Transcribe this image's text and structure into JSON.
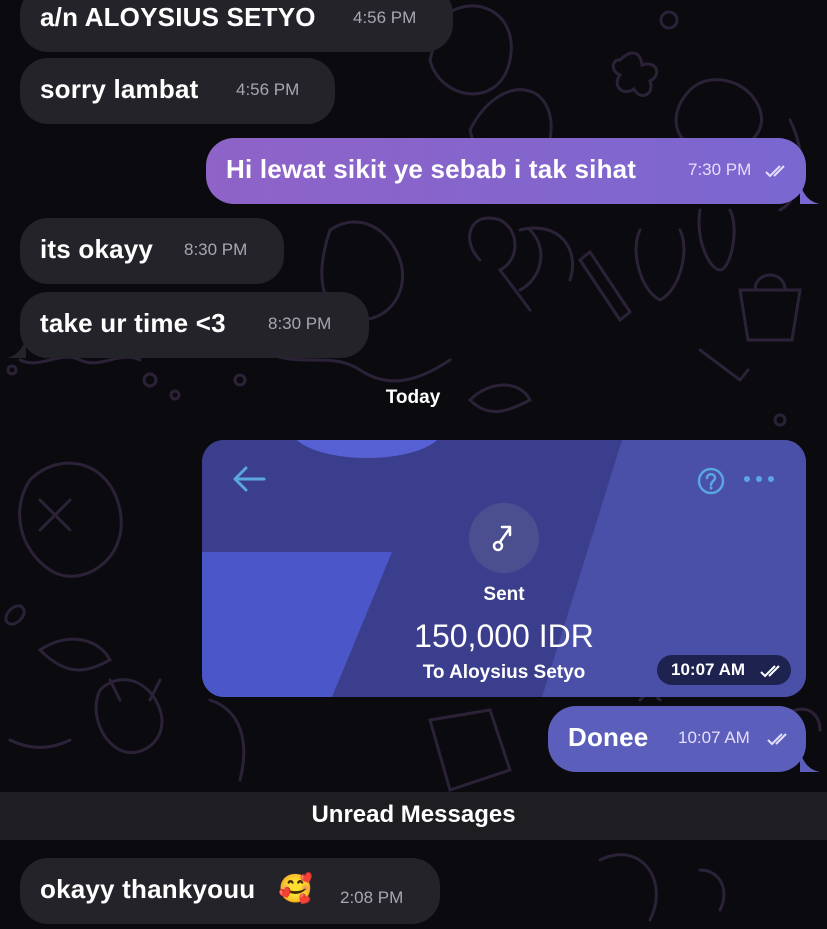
{
  "messages": [
    {
      "text": "a/n ALOYSIUS SETYO",
      "time": "4:56 PM"
    },
    {
      "text": "sorry lambat",
      "time": "4:56 PM"
    },
    {
      "text": "Hi lewat sikit ye sebab i tak sihat",
      "time": "7:30 PM"
    },
    {
      "text": "its okayy",
      "time": "8:30 PM"
    },
    {
      "text": "take ur time <3",
      "time": "8:30 PM"
    },
    {
      "text": "Donee",
      "time": "10:07 AM"
    },
    {
      "text": "okayy thankyouu",
      "emoji": "🥰",
      "time": "2:08 PM"
    }
  ],
  "date_separator": "Today",
  "unread_label": "Unread Messages",
  "photo": {
    "status": "Sent",
    "amount": "150,000 IDR",
    "recipient": "To Aloysius Setyo",
    "time": "10:07 AM",
    "icons": [
      "back-arrow-icon",
      "help-icon",
      "more-icon",
      "sent-arrow-icon"
    ]
  },
  "colors": {
    "background": "#0b0a0f",
    "incoming_bubble": "#25232a",
    "outgoing_bubble": "#8f63c8",
    "outgoing_bubble_alt": "#5b5fbb",
    "unread_bar": "#1e1d21"
  }
}
